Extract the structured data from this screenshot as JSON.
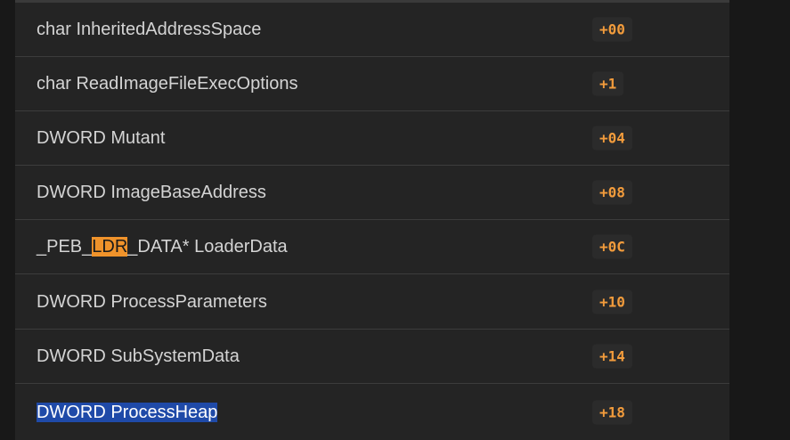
{
  "struct_rows": [
    {
      "field": "char InheritedAddressSpace",
      "offset": "+00"
    },
    {
      "field": "char ReadImageFileExecOptions",
      "offset": "+1"
    },
    {
      "field": "DWORD Mutant",
      "offset": "+04"
    },
    {
      "field": "DWORD ImageBaseAddress",
      "offset": "+08"
    },
    {
      "field_pre": "_PEB_",
      "field_highlight": "LDR",
      "field_post": "_DATA* LoaderData",
      "offset": "+0C"
    },
    {
      "field": "DWORD ProcessParameters",
      "offset": "+10"
    },
    {
      "field": "DWORD SubSystemData",
      "offset": "+14"
    },
    {
      "field": "DWORD ProcessHeap",
      "offset": "+18"
    }
  ],
  "colors": {
    "offset_text": "#f39c3c",
    "search_highlight": "#f0932b",
    "selection_highlight": "#1f4aa8"
  }
}
